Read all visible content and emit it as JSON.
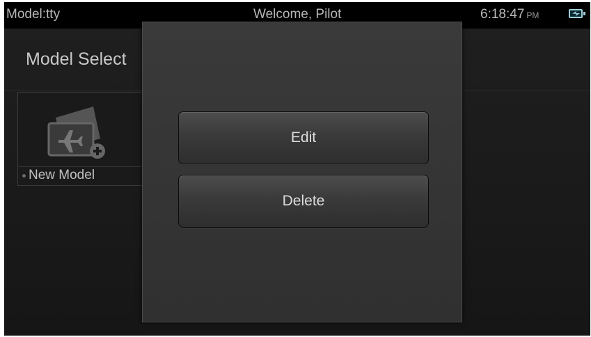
{
  "statusbar": {
    "model_label": "Model:tty",
    "welcome": "Welcome, Pilot",
    "time": "6:18:47",
    "ampm": "PM",
    "battery_icon": "battery-charging-icon"
  },
  "main": {
    "title": "Model Select",
    "tile": {
      "label": "New Model",
      "icon": "airplane-add-icon"
    }
  },
  "dialog": {
    "edit_label": "Edit",
    "delete_label": "Delete"
  },
  "colors": {
    "background": "#000000",
    "dialog": "#353535",
    "text": "#dcdcdc",
    "battery": "#9fd0dc"
  }
}
